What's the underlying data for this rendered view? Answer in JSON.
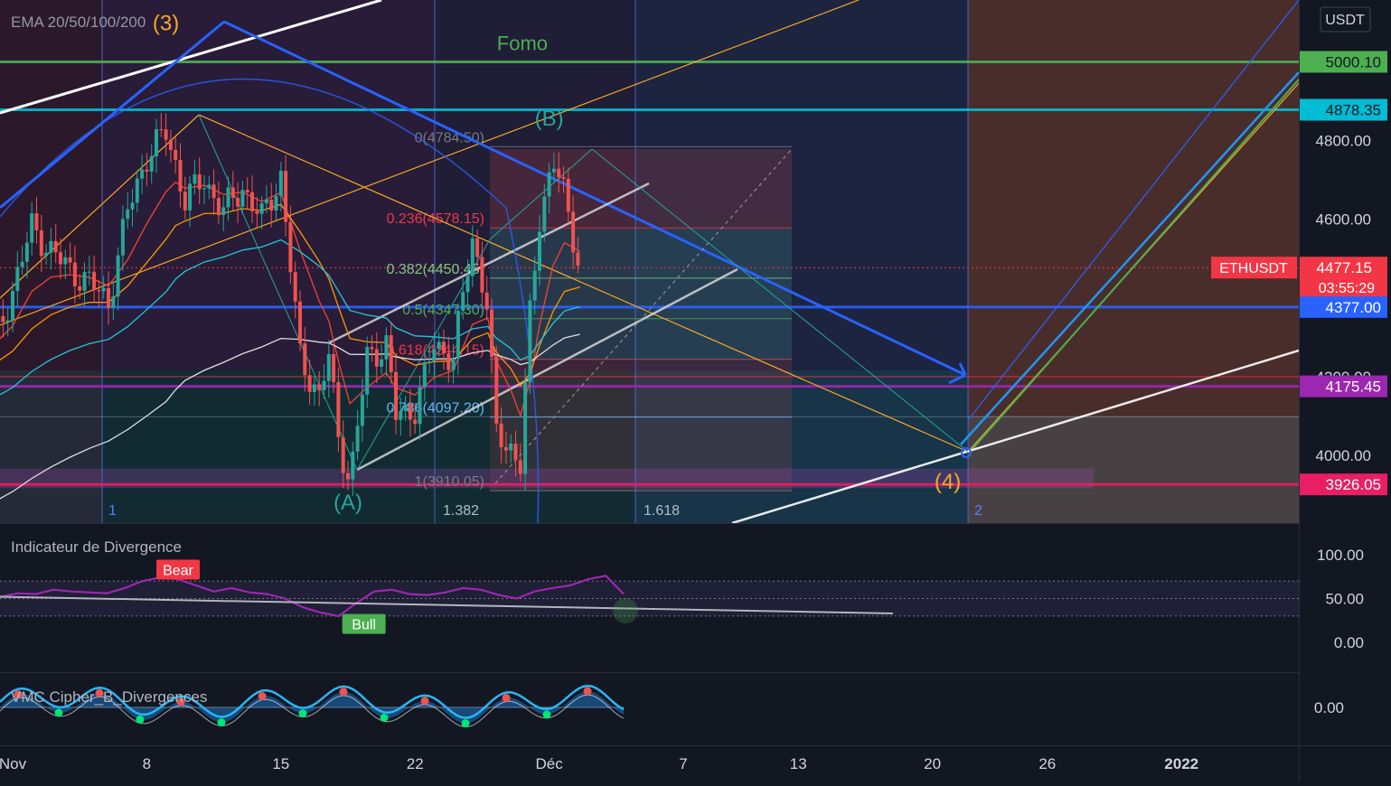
{
  "chart_data": {
    "type": "candlestick",
    "symbol": "ETHUSDT",
    "quote_currency": "USDT",
    "indicator_title": "EMA 20/50/100/200",
    "price_axis": {
      "ylim": [
        3790,
        5190
      ],
      "ticks": [
        "4800.00",
        "4600.00",
        "4200.00",
        "4000.00"
      ],
      "tick_values": [
        4800,
        4600,
        4200,
        4000
      ]
    },
    "x_axis": {
      "ticks": [
        "Nov",
        "8",
        "15",
        "22",
        "Déc",
        "7",
        "13",
        "20",
        "26",
        "2022"
      ],
      "tick_days": [
        1,
        8,
        15,
        22,
        29,
        36,
        42,
        49,
        55,
        62
      ]
    },
    "price_labels": [
      {
        "text": "5000.10",
        "value": 5000.1,
        "color": "#4caf50"
      },
      {
        "text": "4878.35",
        "value": 4878.35,
        "color": "#00bcd4"
      },
      {
        "text": "4377.00",
        "value": 4377.0,
        "color": "#2962ff"
      },
      {
        "text": "4175.45",
        "value": 4175.45,
        "color": "#9c27b0"
      },
      {
        "text": "3926.05",
        "value": 3926.05,
        "color": "#e91e63"
      }
    ],
    "last_price": {
      "symbol": "ETHUSDT",
      "price": "4477.15",
      "countdown": "03:55:29",
      "value": 4477.15,
      "color": "#f23645"
    },
    "fib_levels": [
      {
        "label": "0(4784.50)",
        "value": 4784.5,
        "color": "#787b86"
      },
      {
        "label": "0.236(4578.15)",
        "value": 4578.15,
        "color": "#f23645"
      },
      {
        "label": "0.382(4450.45)",
        "value": 4450.45,
        "color": "#81c784"
      },
      {
        "label": "0.5(4347.30)",
        "value": 4347.3,
        "color": "#4caf50"
      },
      {
        "label": "0.618(4244.15)",
        "value": 4244.15,
        "color": "#f23645"
      },
      {
        "label": "0.786(4097.20)",
        "value": 4097.2,
        "color": "#64b5f6"
      },
      {
        "label": "1(3910.05)",
        "value": 3910.05,
        "color": "#787b86"
      }
    ],
    "fib_time_labels": [
      "1",
      "1.382",
      "1.618",
      "2"
    ],
    "wave_labels": [
      {
        "text": "(3)",
        "day": 9,
        "price": 5080,
        "color": "#f9a825"
      },
      {
        "text": "(A)",
        "day": 18.5,
        "price": 3862,
        "color": "#26a69a"
      },
      {
        "text": "(B)",
        "day": 29,
        "price": 4838,
        "color": "#26a69a"
      },
      {
        "text": "(4)",
        "day": 49.8,
        "price": 3915,
        "color": "#f9a825"
      }
    ],
    "annotations": [
      {
        "text": "Fomo",
        "day": 27.6,
        "price": 5030
      }
    ],
    "close_series": [
      {
        "day": 0,
        "price": 4280
      },
      {
        "day": 1,
        "price": 4420
      },
      {
        "day": 2,
        "price": 4580
      },
      {
        "day": 3,
        "price": 4520
      },
      {
        "day": 4,
        "price": 4470
      },
      {
        "day": 5,
        "price": 4440
      },
      {
        "day": 6,
        "price": 4390
      },
      {
        "day": 7,
        "price": 4620
      },
      {
        "day": 8,
        "price": 4760
      },
      {
        "day": 9,
        "price": 4820
      },
      {
        "day": 9.5,
        "price": 4740
      },
      {
        "day": 10,
        "price": 4650
      },
      {
        "day": 11,
        "price": 4700
      },
      {
        "day": 12,
        "price": 4620
      },
      {
        "day": 13,
        "price": 4680
      },
      {
        "day": 14,
        "price": 4600
      },
      {
        "day": 15,
        "price": 4710
      },
      {
        "day": 16,
        "price": 4250
      },
      {
        "day": 17,
        "price": 4150
      },
      {
        "day": 17.5,
        "price": 4250
      },
      {
        "day": 18,
        "price": 4050
      },
      {
        "day": 18.6,
        "price": 3930
      },
      {
        "day": 19.5,
        "price": 4250
      },
      {
        "day": 20.5,
        "price": 4280
      },
      {
        "day": 21,
        "price": 4100
      },
      {
        "day": 22,
        "price": 4120
      },
      {
        "day": 23,
        "price": 4280
      },
      {
        "day": 24,
        "price": 4250
      },
      {
        "day": 25,
        "price": 4550
      },
      {
        "day": 25.8,
        "price": 4380
      },
      {
        "day": 26.2,
        "price": 4050
      },
      {
        "day": 27,
        "price": 4020
      },
      {
        "day": 27.5,
        "price": 3980
      },
      {
        "day": 28,
        "price": 4350
      },
      {
        "day": 28.5,
        "price": 4600
      },
      {
        "day": 29.2,
        "price": 4760
      },
      {
        "day": 29.8,
        "price": 4650
      },
      {
        "day": 30.6,
        "price": 4477
      }
    ],
    "divergence_indicator": {
      "title": "Indicateur de Divergence",
      "ticks": [
        "100.00",
        "50.00",
        "0.00"
      ],
      "tick_values": [
        100,
        50,
        0
      ],
      "ylim": [
        -20,
        120
      ],
      "signals": [
        {
          "text": "Bear",
          "day": 8.5,
          "value": 82,
          "color": "#f23645"
        },
        {
          "text": "Bull",
          "day": 18.2,
          "value": 20,
          "color": "#4caf50"
        }
      ],
      "values": [
        52,
        56,
        55,
        60,
        58,
        57,
        56,
        62,
        70,
        74,
        72,
        65,
        58,
        62,
        57,
        55,
        50,
        40,
        34,
        30,
        45,
        58,
        60,
        55,
        54,
        57,
        62,
        60,
        54,
        50,
        58,
        62,
        65,
        72,
        76,
        55
      ]
    },
    "cipher_b": {
      "title": "VMC Cipher_B_Divergences",
      "ticks": [
        "0.00"
      ],
      "tick_values": [
        0
      ]
    }
  }
}
